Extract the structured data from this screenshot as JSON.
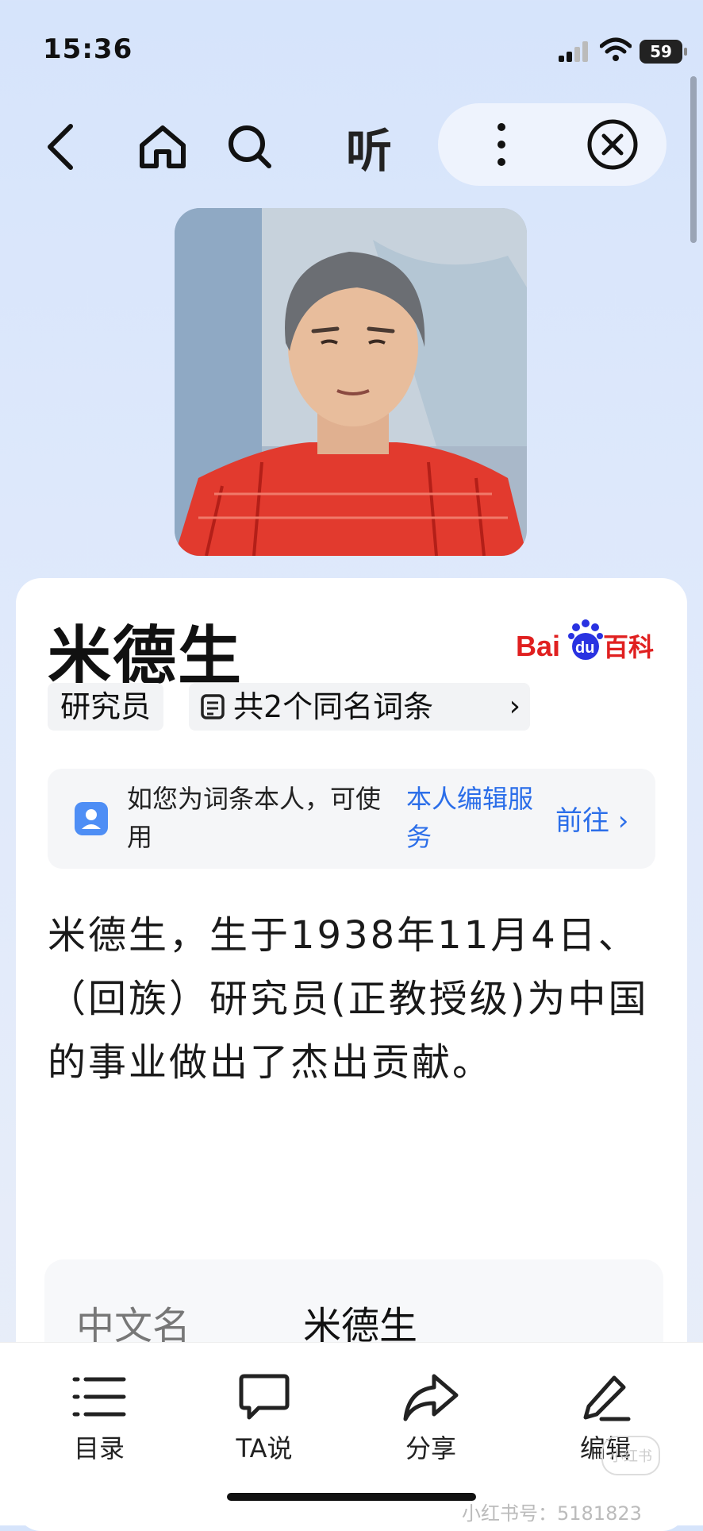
{
  "status_bar": {
    "time": "15:36",
    "battery": "59"
  },
  "nav": {
    "listen_label": "听"
  },
  "entry": {
    "title": "米德生",
    "logo_text_bai": "Bai",
    "logo_text_du": "du",
    "logo_text_baike": "百科",
    "role_tag": "研究员",
    "same_name_label": "共2个同名词条",
    "notice_text": "如您为词条本人，可使用",
    "notice_link": "本人编辑服务",
    "notice_go": "前往 ›",
    "summary": "米德生，生于1938年11月4日、（回族）研究员(正教授级)为中国的事业做出了杰出贡献。",
    "infobox": {
      "label": "中文名",
      "value": "米德生"
    }
  },
  "bottom_tabs": [
    {
      "label": "目录"
    },
    {
      "label": "TA说"
    },
    {
      "label": "分享"
    },
    {
      "label": "编辑"
    }
  ],
  "watermark": "小红书号：5181823",
  "watermark_logo": "小红书",
  "colors": {
    "accent": "#2b6ee9",
    "baidu_red": "#e02020",
    "baidu_blue": "#2932e1"
  }
}
